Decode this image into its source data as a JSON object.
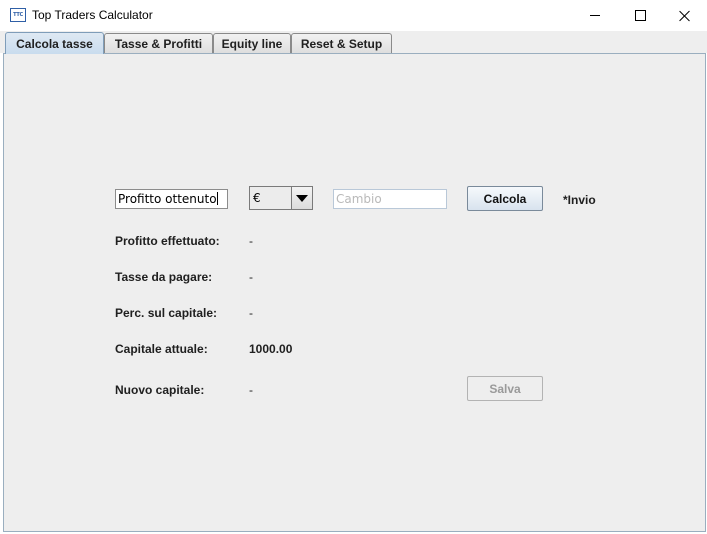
{
  "window": {
    "title": "Top Traders Calculator",
    "icon_text": "TTC"
  },
  "tabs": [
    {
      "label": "Calcola tasse",
      "active": true
    },
    {
      "label": "Tasse & Profitti",
      "active": false
    },
    {
      "label": "Equity line",
      "active": false
    },
    {
      "label": "Reset & Setup",
      "active": false
    }
  ],
  "form": {
    "profit_input_value": "Profitto ottenuto",
    "currency_selected": "€",
    "exchange_placeholder": "Cambio",
    "calculate_label": "Calcola",
    "enter_hint": "*Invio",
    "save_label": "Salva"
  },
  "results": [
    {
      "label": "Profitto effettuato:",
      "value": "-"
    },
    {
      "label": "Tasse da pagare:",
      "value": "-"
    },
    {
      "label": "Perc. sul capitale:",
      "value": "-"
    },
    {
      "label": "Capitale attuale:",
      "value": "1000.00"
    },
    {
      "label": "Nuovo capitale:",
      "value": "-"
    }
  ]
}
